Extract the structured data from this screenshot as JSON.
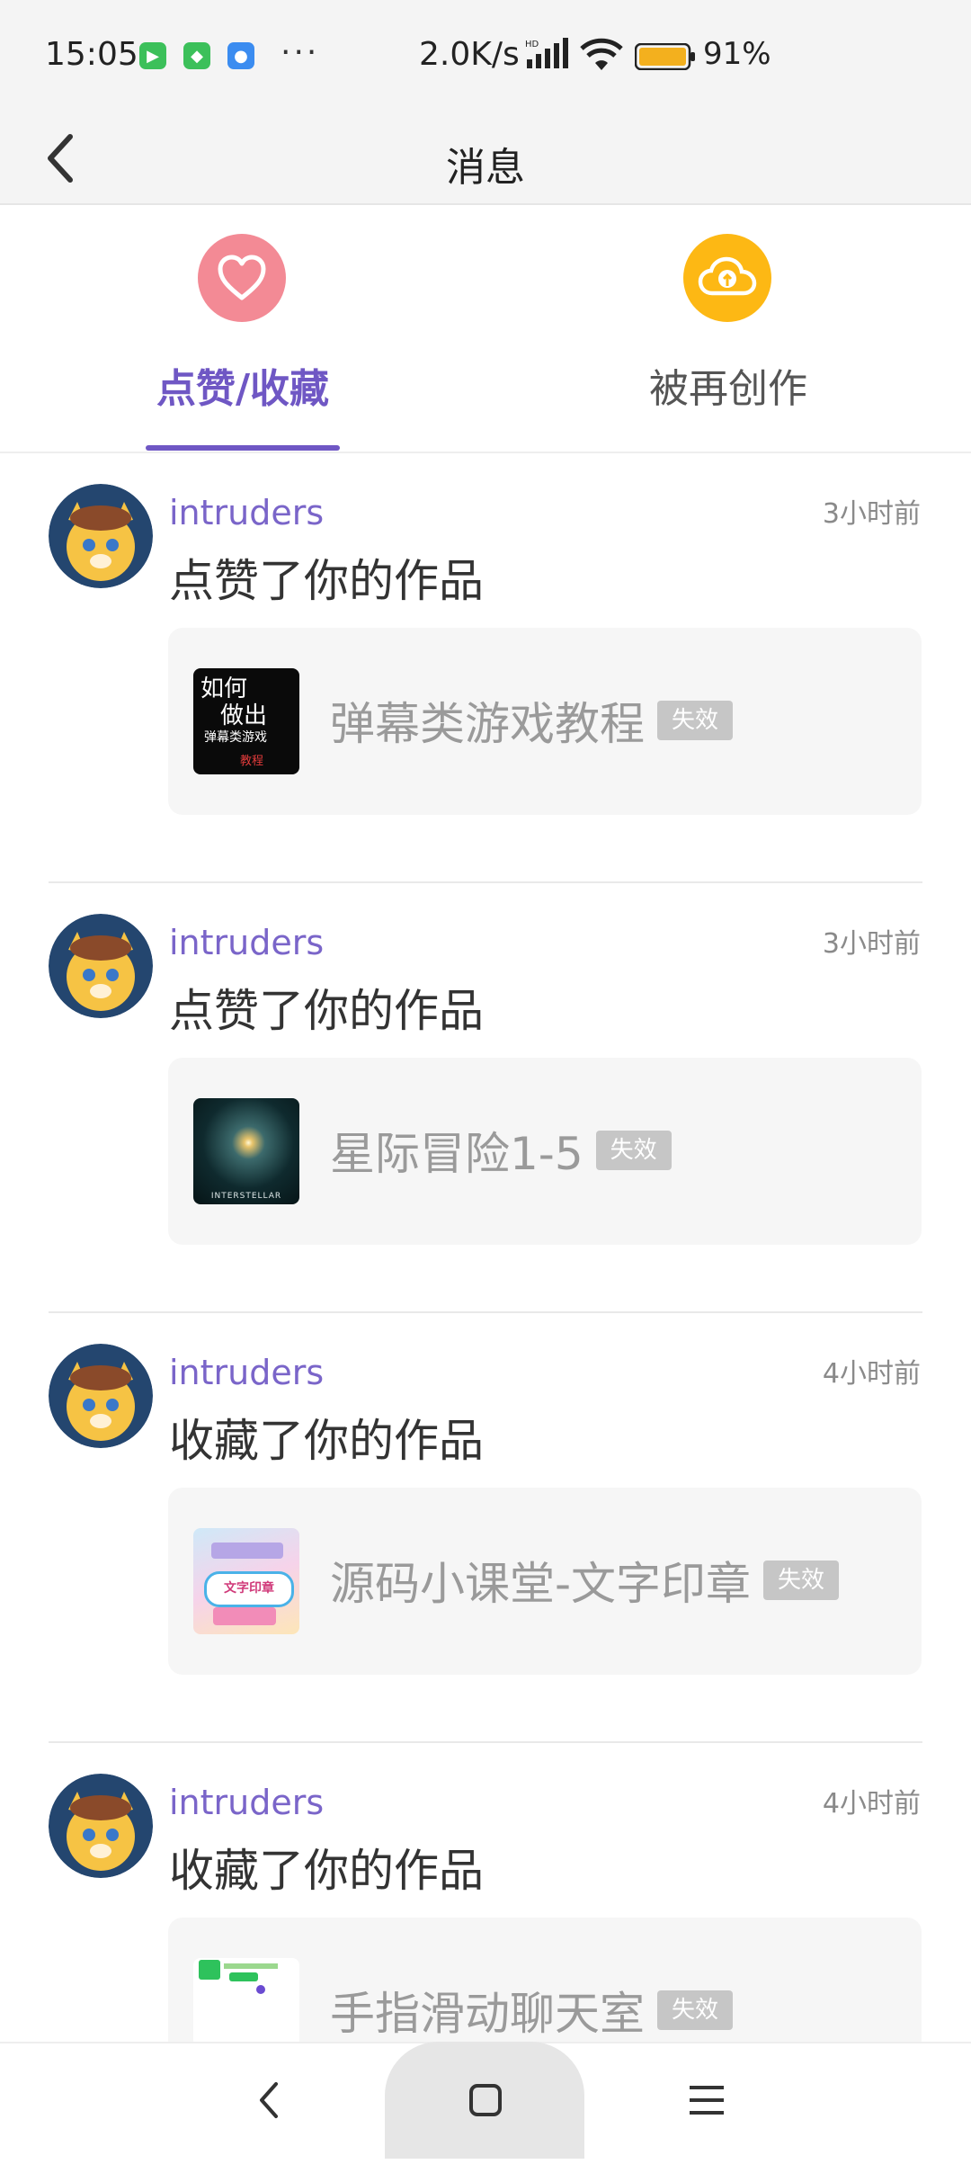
{
  "status_bar": {
    "time": "15:05",
    "network_speed": "2.0K/s",
    "battery": "91%",
    "app_icons": [
      "wechat-icon",
      "shield-icon",
      "browser-icon"
    ],
    "more": "···"
  },
  "header": {
    "title": "消息"
  },
  "tabs": [
    {
      "label": "点赞/收藏",
      "icon": "heart-icon",
      "active": true,
      "color": "#f38a95"
    },
    {
      "label": "被再创作",
      "icon": "cloud-icon",
      "active": false,
      "color": "#fdb814"
    }
  ],
  "messages": [
    {
      "user": "intruders",
      "time": "3小时前",
      "action": "点赞了你的作品",
      "work_title": "弹幕类游戏教程",
      "badge": "失效",
      "thumb": "tutorial-cover"
    },
    {
      "user": "intruders",
      "time": "3小时前",
      "action": "点赞了你的作品",
      "work_title": "星际冒险1-5",
      "badge": "失效",
      "thumb": "interstellar-cover"
    },
    {
      "user": "intruders",
      "time": "4小时前",
      "action": "收藏了你的作品",
      "work_title": "源码小课堂-文字印章",
      "badge": "失效",
      "thumb": "stamp-cover"
    },
    {
      "user": "intruders",
      "time": "4小时前",
      "action": "收藏了你的作品",
      "work_title": "手指滑动聊天室",
      "badge": "失效",
      "thumb": "chat-cover"
    }
  ],
  "thumbs": {
    "tutorial": {
      "line1": "如何",
      "line2": "做出",
      "line3": "弹幕类游戏",
      "line4": "教程"
    },
    "interstellar": {
      "caption": "INTERSTELLAR"
    },
    "stamp": {
      "text": "文字印章"
    }
  },
  "nav": [
    "back-icon",
    "home-icon",
    "menu-icon"
  ],
  "colors": {
    "accent": "#6f57c4",
    "username": "#7a65c9",
    "badge": "#c6c6c6"
  }
}
